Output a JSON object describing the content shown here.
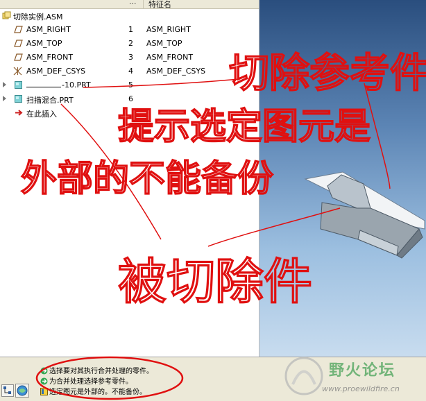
{
  "tree": {
    "columns": {
      "dots": "...",
      "feature_name": "特征名"
    },
    "root": {
      "label": "切除实例.ASM"
    },
    "items": [
      {
        "label": "ASM_RIGHT",
        "num": "1",
        "feature": "ASM_RIGHT"
      },
      {
        "label": "ASM_TOP",
        "num": "2",
        "feature": "ASM_TOP"
      },
      {
        "label": "ASM_FRONT",
        "num": "3",
        "feature": "ASM_FRONT"
      },
      {
        "label": "ASM_DEF_CSYS",
        "num": "4",
        "feature": "ASM_DEF_CSYS"
      },
      {
        "label": "-10.PRT",
        "num": "5",
        "feature": ""
      },
      {
        "label": "扫描混合.PRT",
        "num": "6",
        "feature": ""
      }
    ],
    "insert_here": "在此插入"
  },
  "status": {
    "messages": [
      "选择要对其执行合并处理的零件。",
      "为合并处理选择参考零件。",
      "选定图元是外部的。不能备份。"
    ]
  },
  "watermark": {
    "title": "野火论坛",
    "url": "www.proewildfire.cn"
  },
  "annotations": {
    "text1": "切除参考件",
    "text2": "提示选定图元是",
    "text3": "外部的不能备份",
    "text4": "被切除件"
  },
  "colors": {
    "annotation": "#e01010",
    "viewport_top": "#2a4e7e",
    "viewport_bottom": "#c8dcef"
  }
}
